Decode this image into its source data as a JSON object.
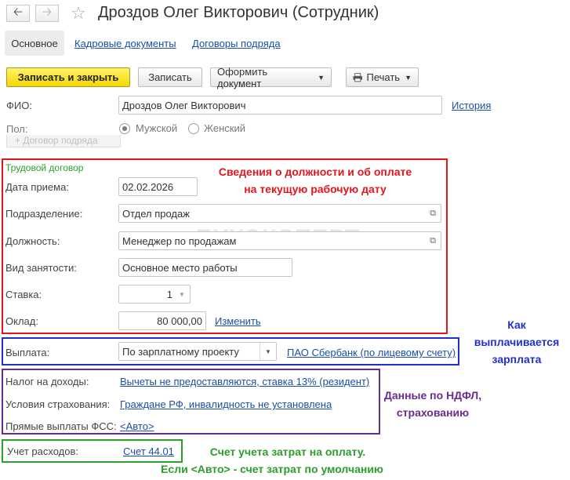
{
  "window": {
    "title": "Дроздов Олег Викторович (Сотрудник)"
  },
  "icons": {
    "back": "arrow-left-icon",
    "forward": "arrow-right-icon",
    "favorite": "star-icon",
    "print": "printer-icon",
    "open": "open-form-icon",
    "dropdown": "chevron-down-icon"
  },
  "tabs": [
    {
      "label": "Основное",
      "active": true
    },
    {
      "label": "Кадровые документы",
      "active": false
    },
    {
      "label": "Договоры подряда",
      "active": false
    }
  ],
  "toolbar": {
    "save_close": "Записать и закрыть",
    "save": "Записать",
    "create_doc": "Оформить документ",
    "print": "Печать"
  },
  "form": {
    "fio_label": "ФИО:",
    "fio_value": "Дроздов Олег Викторович",
    "history_link": "История",
    "gender_label": "Пол:",
    "gender_male": "Мужской",
    "gender_female": "Женский",
    "contract_button": "+ Договор подряда",
    "section_title": "Трудовой договор",
    "hire_date_label": "Дата приема:",
    "hire_date_value": "02.02.2026",
    "department_label": "Подразделение:",
    "department_value": "Отдел продаж",
    "position_label": "Должность:",
    "position_value": "Менеджер по продажам",
    "employment_label": "Вид занятости:",
    "employment_value": "Основное место работы",
    "rate_label": "Ставка:",
    "rate_value": "1",
    "salary_label": "Оклад:",
    "salary_value": "80 000,00",
    "salary_change_link": "Изменить",
    "payment_label": "Выплата:",
    "payment_value": "По зарплатному проекту",
    "payment_bank_link": "ПАО Сбербанк (по лицевому счету)",
    "tax_label": "Налог на доходы:",
    "tax_link": "Вычеты не предоставляются, ставка 13% (резидент)",
    "insurance_label": "Условия страхования:",
    "insurance_link": "Граждане РФ, инвалидность не установлена",
    "fss_label": "Прямые выплаты ФСС:",
    "fss_link": "<Авто>",
    "expense_label": "Учет расходов:",
    "expense_link": "Счет 44.01"
  },
  "annotations": {
    "red_line1": "Сведения о должности и об оплате",
    "red_line2": "на текущую рабочую дату",
    "blue_line1": "Как",
    "blue_line2": "выплачивается",
    "blue_line3": "зарплата",
    "purple_line1": "Данные по НДФЛ,",
    "purple_line2": "страхованию",
    "green_line1": "Счет учета затрат на оплату.",
    "green_line2": "Если <Авто> - счет затрат по умолчанию"
  },
  "watermark": "БУХЭКСПЕРТ",
  "colors": {
    "red_frame": "#e8141c",
    "blue_frame": "#1f2fd0",
    "purple_frame": "#6b2c8f",
    "green_frame": "#2c9e2c",
    "link": "#1a4fa6",
    "primary_button": "#f5d800"
  }
}
